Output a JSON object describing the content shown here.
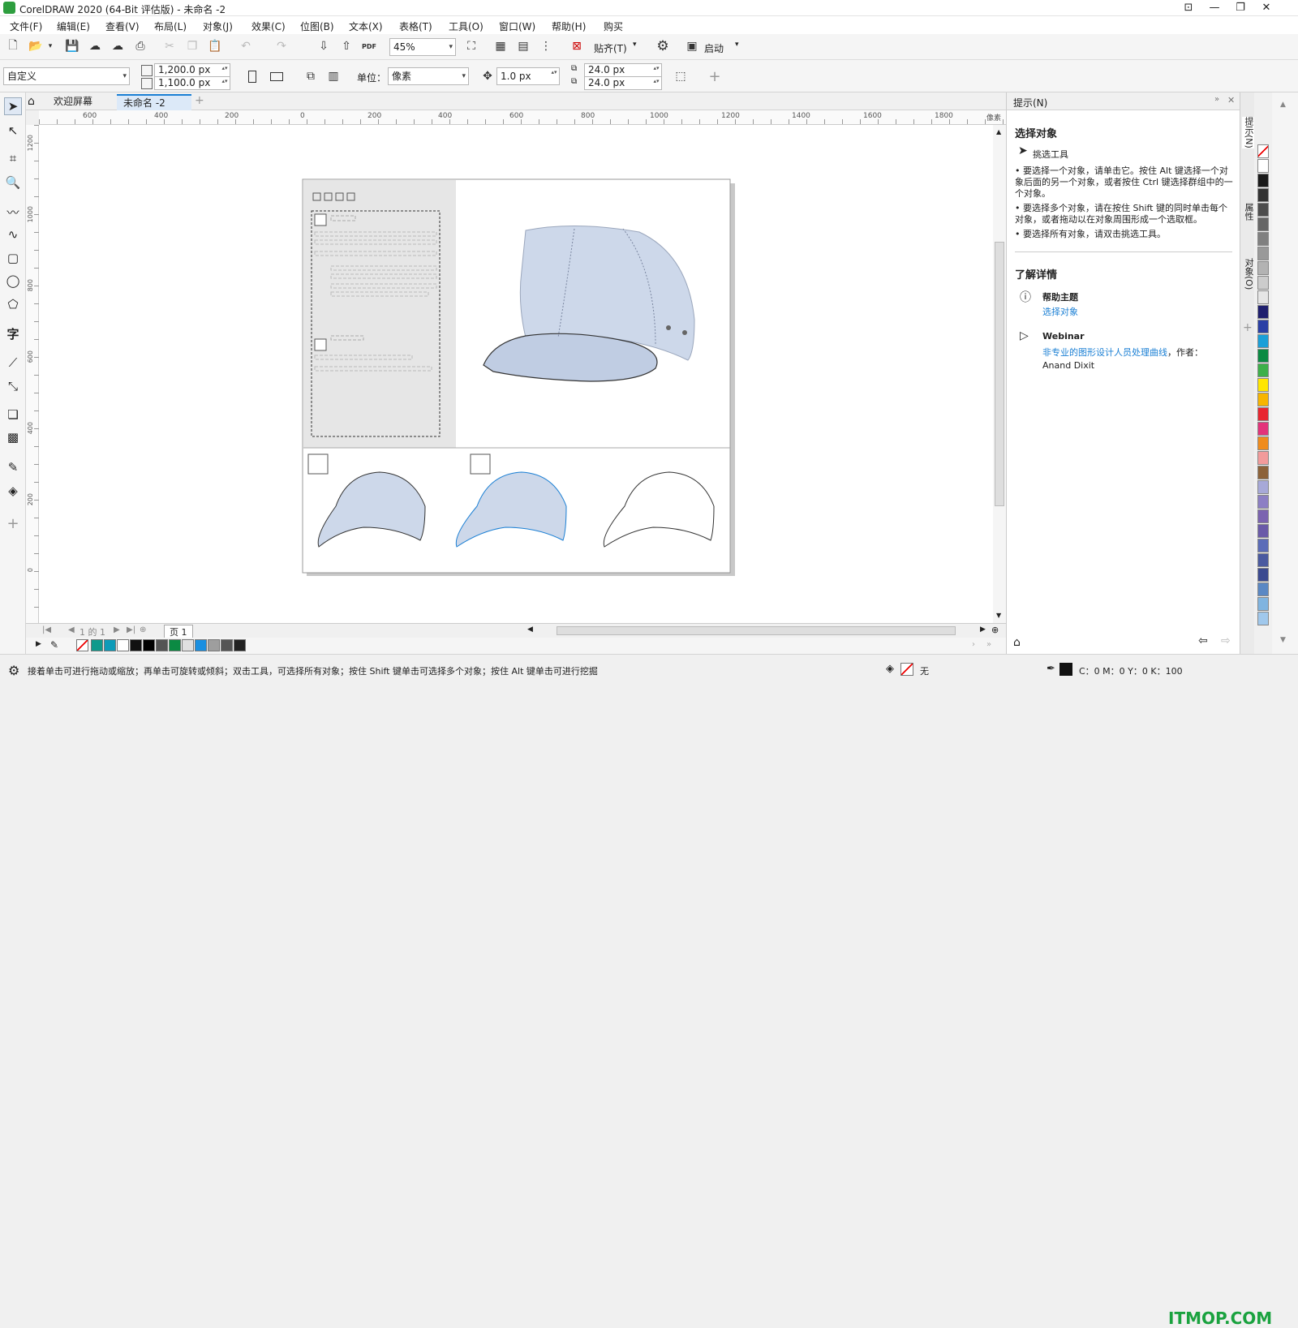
{
  "app": {
    "title": "CorelDRAW 2020 (64-Bit 评估版) - 未命名 -2"
  },
  "menu": [
    "文件(F)",
    "编辑(E)",
    "查看(V)",
    "布局(L)",
    "对象(J)",
    "效果(C)",
    "位图(B)",
    "文本(X)",
    "表格(T)",
    "工具(O)",
    "窗口(W)",
    "帮助(H)",
    "购买"
  ],
  "toolbar": {
    "zoom": "45%",
    "snap_label": "贴齐(T)",
    "launch_label": "启动"
  },
  "propbar": {
    "preset": "自定义",
    "width": "1,200.0 px",
    "height": "1,100.0 px",
    "unit_label": "单位：",
    "unit_value": "像素",
    "nudge": "1.0 px",
    "dup_x": "24.0 px",
    "dup_y": "24.0 px"
  },
  "doc_tabs": {
    "welcome": "欢迎屏幕",
    "current": "未命名 -2"
  },
  "ruler": {
    "h_ticks": [
      "600",
      "400",
      "200",
      "0",
      "200",
      "400",
      "600",
      "800",
      "1000",
      "1200",
      "1400",
      "1600",
      "1800"
    ],
    "h_unit": "像素",
    "v_ticks": [
      "1200",
      "1000",
      "800",
      "600",
      "400",
      "200",
      "0"
    ]
  },
  "page_nav": {
    "page_of": "1 的 1",
    "page_tab": "页 1"
  },
  "panel": {
    "header": "提示(N)",
    "section_title": "选择对象",
    "tool_name": "挑选工具",
    "bullets": [
      "要选择一个对象，请单击它。按住 Alt 键选择一个对象后面的另一个对象，或者按住 Ctrl 键选择群组中的一个对象。",
      "要选择多个对象，请在按住 Shift 键的同时单击每个对象，或者拖动以在对象周围形成一个选取框。",
      "要选择所有对象，请双击挑选工具。"
    ],
    "learn_title": "了解详情",
    "help_title": "帮助主题",
    "help_link": "选择对象",
    "webinar_title": "Webinar",
    "webinar_link": "非专业的图形设计人员处理曲线",
    "webinar_author_prefix": "，作者：",
    "webinar_author": "Anand Dixit"
  },
  "docker_tabs": [
    "提示(N)",
    "属性",
    "对象(O)"
  ],
  "status": {
    "hint": "接着单击可进行拖动或缩放；再单击可旋转或倾斜；双击工具，可选择所有对象；按住 Shift 键单击可选择多个对象；按住 Alt 键单击可进行挖掘",
    "fill_none": "无",
    "cmyk": "C：0 M：0 Y：0 K：100"
  },
  "watermark": "ITMOP.COM",
  "colors": {
    "accent_blue": "#1a7fd4",
    "cap_fill": "#cdd8ea",
    "logo_green": "#2e9e3f"
  },
  "palette_colors": [
    "#ffffff",
    "#1a1a1a",
    "#333333",
    "#4d4d4d",
    "#666666",
    "#808080",
    "#999999",
    "#b3b3b3",
    "#cccccc",
    "#e6e6e6",
    "#1f1f6e",
    "#2a3fa5",
    "#1a9fd8",
    "#0b8a43",
    "#3db04a",
    "#ffe600",
    "#f7b500",
    "#e8262f",
    "#e3337a",
    "#f08c1c",
    "#f29b9b",
    "#8c6239",
    "#a7a9d8",
    "#8c7fc4",
    "#7b63b0",
    "#6a5aa8",
    "#5b6cb8",
    "#4a5aa0",
    "#3b4a90",
    "#5a88c4",
    "#80b4e0",
    "#a0c8ec"
  ],
  "bottom_colors": [
    "#0f9a8c",
    "#0e9bb8",
    "#ffffff",
    "#111111",
    "#000000",
    "#545454",
    "#0b8a43",
    "#e0e0e0",
    "#1a8fe0",
    "#9e9e9e",
    "#555555",
    "#222222"
  ]
}
